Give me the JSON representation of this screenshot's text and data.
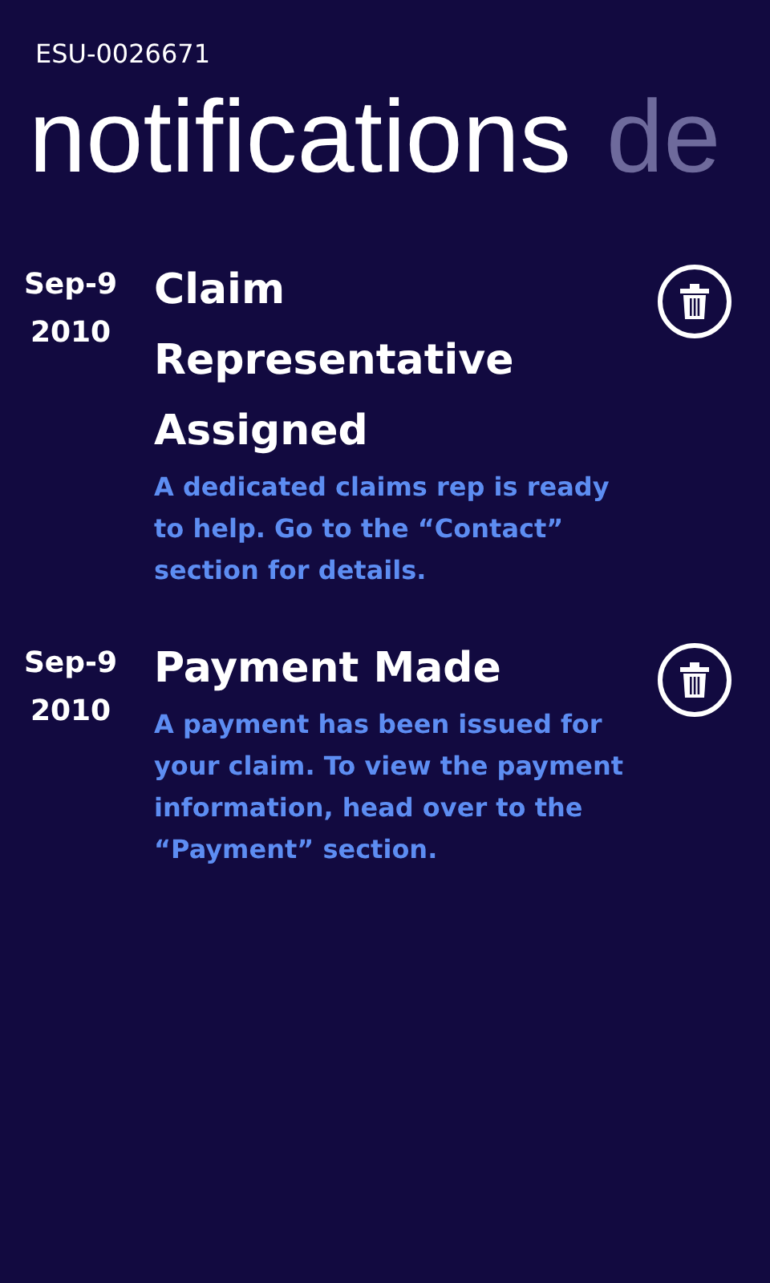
{
  "app_title": "ESU-0026671",
  "pivot": [
    {
      "label": "notifications",
      "selected": true
    },
    {
      "label": "de",
      "selected": false
    }
  ],
  "notifications": [
    {
      "month_day": "Sep-9",
      "year": "2010",
      "title": "Claim Representative Assigned",
      "message": "A dedicated claims rep is ready to help. Go to the “Contact” section for details."
    },
    {
      "month_day": "Sep-9",
      "year": "2010",
      "title": "Payment Made",
      "message": "A payment has been issued for your claim. To view the payment information, head over to the “Payment” section."
    }
  ]
}
